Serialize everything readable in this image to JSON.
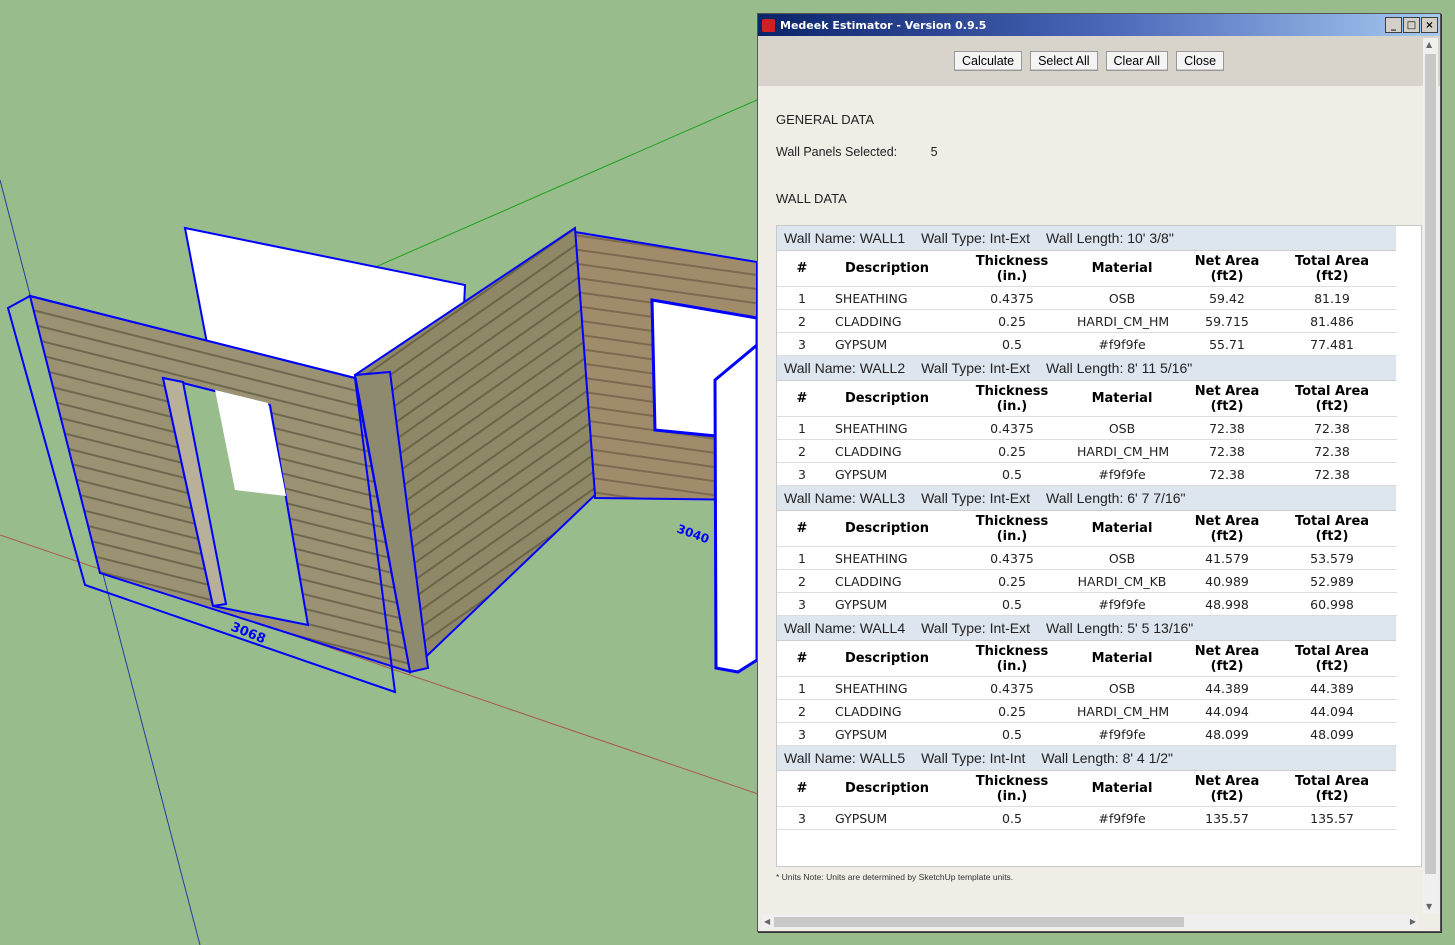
{
  "window": {
    "title": "Medeek Estimator - Version 0.9.5",
    "minimize": "_",
    "maximize": "□",
    "close": "×"
  },
  "toolbar": {
    "calculate": "Calculate",
    "select_all": "Select All",
    "clear_all": "Clear All",
    "close": "Close"
  },
  "general": {
    "heading": "GENERAL DATA",
    "panels_label": "Wall Panels Selected:",
    "panels_value": "5"
  },
  "wall_data_heading": "WALL DATA",
  "columns": {
    "num": "#",
    "desc": "Description",
    "thick1": "Thickness",
    "thick2": "(in.)",
    "material": "Material",
    "net1": "Net Area",
    "net2": "(ft2)",
    "total1": "Total Area",
    "total2": "(ft2)"
  },
  "walls": [
    {
      "name": "Wall Name: WALL1",
      "type": "Wall Type: Int-Ext",
      "length": "Wall Length: 10' 3/8\"",
      "rows": [
        [
          "1",
          "SHEATHING",
          "0.4375",
          "OSB",
          "59.42",
          "81.19"
        ],
        [
          "2",
          "CLADDING",
          "0.25",
          "HARDI_CM_HM",
          "59.715",
          "81.486"
        ],
        [
          "3",
          "GYPSUM",
          "0.5",
          "#f9f9fe",
          "55.71",
          "77.481"
        ]
      ]
    },
    {
      "name": "Wall Name: WALL2",
      "type": "Wall Type: Int-Ext",
      "length": "Wall Length: 8' 11 5/16\"",
      "rows": [
        [
          "1",
          "SHEATHING",
          "0.4375",
          "OSB",
          "72.38",
          "72.38"
        ],
        [
          "2",
          "CLADDING",
          "0.25",
          "HARDI_CM_HM",
          "72.38",
          "72.38"
        ],
        [
          "3",
          "GYPSUM",
          "0.5",
          "#f9f9fe",
          "72.38",
          "72.38"
        ]
      ]
    },
    {
      "name": "Wall Name: WALL3",
      "type": "Wall Type: Int-Ext",
      "length": "Wall Length: 6' 7 7/16\"",
      "rows": [
        [
          "1",
          "SHEATHING",
          "0.4375",
          "OSB",
          "41.579",
          "53.579"
        ],
        [
          "2",
          "CLADDING",
          "0.25",
          "HARDI_CM_KB",
          "40.989",
          "52.989"
        ],
        [
          "3",
          "GYPSUM",
          "0.5",
          "#f9f9fe",
          "48.998",
          "60.998"
        ]
      ]
    },
    {
      "name": "Wall Name: WALL4",
      "type": "Wall Type: Int-Ext",
      "length": "Wall Length: 5' 5 13/16\"",
      "rows": [
        [
          "1",
          "SHEATHING",
          "0.4375",
          "OSB",
          "44.389",
          "44.389"
        ],
        [
          "2",
          "CLADDING",
          "0.25",
          "HARDI_CM_HM",
          "44.094",
          "44.094"
        ],
        [
          "3",
          "GYPSUM",
          "0.5",
          "#f9f9fe",
          "48.099",
          "48.099"
        ]
      ]
    },
    {
      "name": "Wall Name: WALL5",
      "type": "Wall Type: Int-Int",
      "length": "Wall Length: 8' 4 1/2\"",
      "rows": [
        [
          "3",
          "GYPSUM",
          "0.5",
          "#f9f9fe",
          "135.57",
          "135.57"
        ]
      ]
    }
  ],
  "note": "* Units Note: Units are determined by SketchUp template units.",
  "scene": {
    "dim1": "3068",
    "dim2": "3040"
  },
  "colors": {
    "background": "#98bc8c",
    "selection": "#0000ff",
    "siding": "#9a9272"
  }
}
